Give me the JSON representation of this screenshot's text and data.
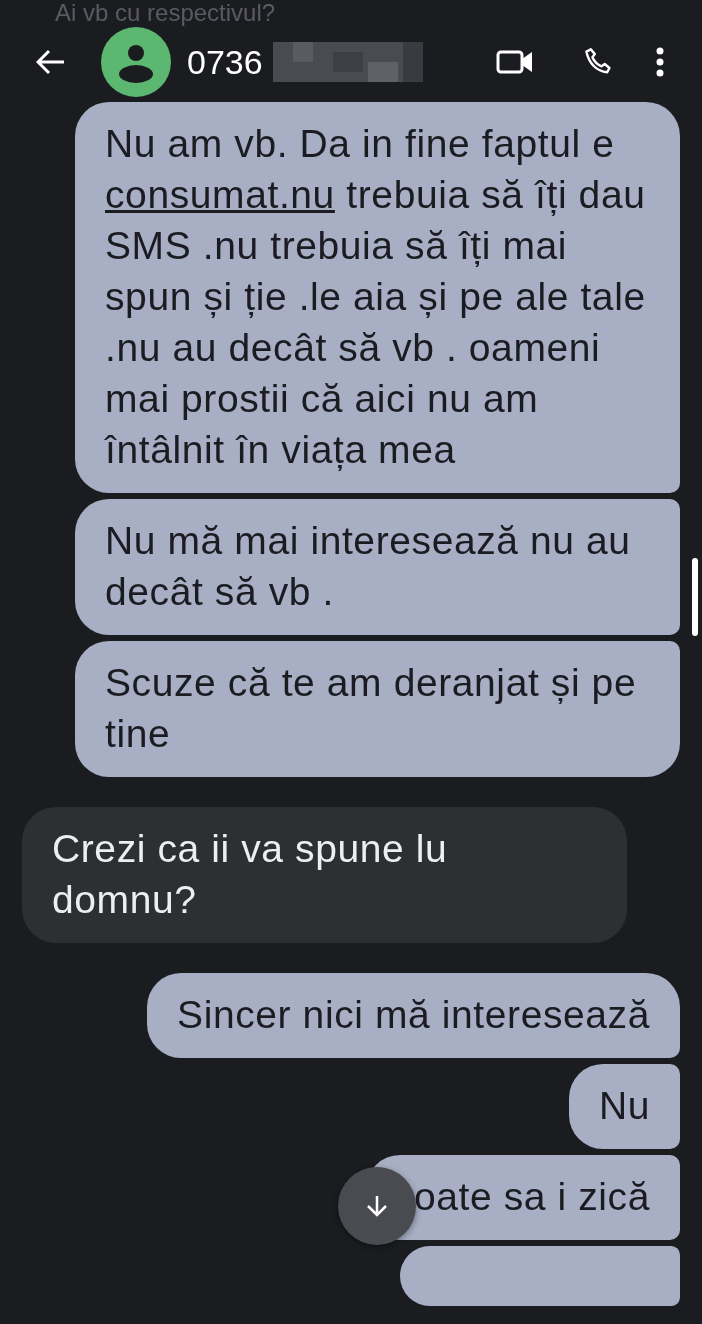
{
  "header": {
    "faded_text": "Ai vb cu respectivul?",
    "contact": "0736",
    "contact_redacted": true
  },
  "messages": [
    {
      "kind": "outgoing",
      "joined_above": false,
      "joined_below": true,
      "segments": [
        {
          "text": "Nu am vb. Da in fine faptul e "
        },
        {
          "text": "consumat.nu",
          "link": true
        },
        {
          "text": " trebuia să îți dau SMS .nu trebuia să îți mai spun și ție .le aia și pe ale tale .nu au decât să vb . oameni mai prostii că aici nu am întâlnit în viața mea"
        }
      ]
    },
    {
      "kind": "outgoing",
      "joined_above": true,
      "joined_below": true,
      "segments": [
        {
          "text": "Nu mă mai interesează nu au decât să vb ."
        }
      ]
    },
    {
      "kind": "outgoing",
      "joined_above": true,
      "joined_below": false,
      "segments": [
        {
          "text": "Scuze că te am deranjat și pe tine"
        }
      ]
    },
    {
      "kind": "incoming",
      "joined_above": false,
      "joined_below": false,
      "segments": [
        {
          "text": "Crezi ca ii va spune lu domnu?"
        }
      ]
    },
    {
      "kind": "outgoing",
      "joined_above": false,
      "joined_below": true,
      "segments": [
        {
          "text": "Sincer nici mă interesează"
        }
      ]
    },
    {
      "kind": "outgoing",
      "joined_above": true,
      "joined_below": true,
      "segments": [
        {
          "text": "Nu"
        }
      ]
    },
    {
      "kind": "outgoing",
      "joined_above": true,
      "joined_below": true,
      "covered": true,
      "segments": [
        {
          "text": "oate sa i zică"
        }
      ]
    },
    {
      "kind": "outgoing",
      "joined_above": true,
      "joined_below": true,
      "partial": true
    }
  ]
}
